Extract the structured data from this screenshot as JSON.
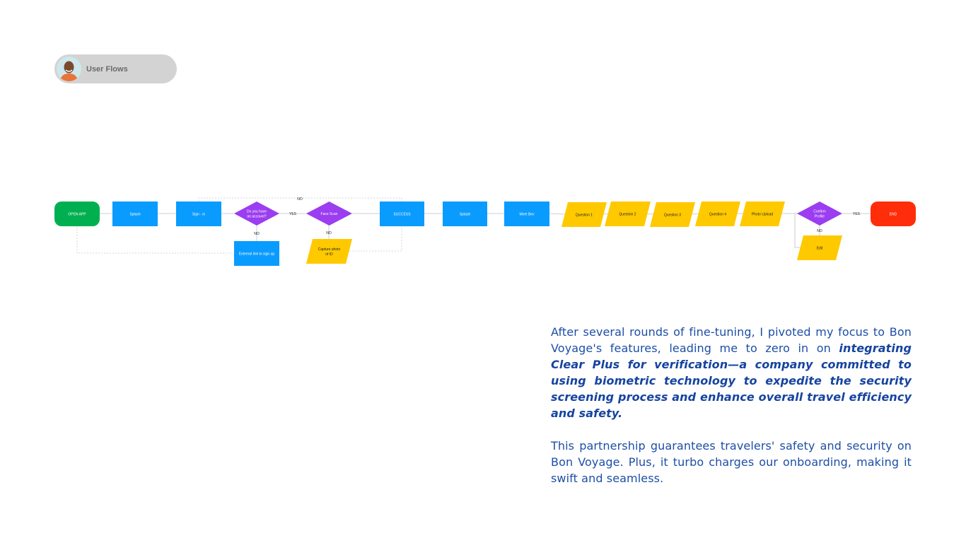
{
  "header": {
    "title": "User Flows",
    "avatar": "person-avatar"
  },
  "flow": {
    "nodes": [
      {
        "id": "open",
        "label": "OPEN APP",
        "shape": "terminal",
        "color": "#00b050"
      },
      {
        "id": "splash",
        "label": "Splash",
        "shape": "process",
        "color": "#0a9bff"
      },
      {
        "id": "signin",
        "label": "Sign - in",
        "shape": "process",
        "color": "#0a9bff"
      },
      {
        "id": "account",
        "label": [
          "Do you have",
          "an account?"
        ],
        "shape": "decision",
        "color": "#9b3df0"
      },
      {
        "id": "facescan",
        "label": "Face Scan",
        "shape": "decision",
        "color": "#9b3df0"
      },
      {
        "id": "success",
        "label": "SUCCESS",
        "shape": "process",
        "color": "#0a9bff"
      },
      {
        "id": "splash2",
        "label": "Splash",
        "shape": "process",
        "color": "#0a9bff"
      },
      {
        "id": "meetbev",
        "label": "Meet Bev",
        "shape": "process",
        "color": "#0a9bff"
      },
      {
        "id": "q1",
        "label": "Question 1",
        "shape": "data",
        "color": "#ffc900"
      },
      {
        "id": "q2",
        "label": "Question 2",
        "shape": "data",
        "color": "#ffc900"
      },
      {
        "id": "q3",
        "label": "Question 3",
        "shape": "data",
        "color": "#ffc900"
      },
      {
        "id": "q4",
        "label": "Question 4",
        "shape": "data",
        "color": "#ffc900"
      },
      {
        "id": "photo",
        "label": "Photo Upload",
        "shape": "data",
        "color": "#ffc900"
      },
      {
        "id": "confirm",
        "label": [
          "Confirm",
          "Profile"
        ],
        "shape": "decision",
        "color": "#9b3df0"
      },
      {
        "id": "end",
        "label": "END",
        "shape": "terminal",
        "color": "#ff2d0a"
      },
      {
        "id": "external",
        "label": "External link to sign up",
        "shape": "process",
        "color": "#0a9bff"
      },
      {
        "id": "capture",
        "label": [
          "Capture photo",
          "of ID"
        ],
        "shape": "data",
        "color": "#ffc900"
      },
      {
        "id": "edit",
        "label": "Edit",
        "shape": "data",
        "color": "#ffc900"
      }
    ],
    "edge_labels": {
      "no_top": "NO",
      "yes_account": "YES",
      "no_account": "NO",
      "no_face": "NO",
      "yes_confirm": "YES",
      "no_confirm": "NO"
    }
  },
  "content": {
    "p1_start": "After several rounds of fine-tuning, I pivoted my focus to Bon Voyage's features, leading me to zero in on ",
    "p1_emph": "integrating Clear Plus for verification—a company committed to using biometric technology to expedite the security screening process and enhance overall travel efficiency and safety.",
    "p2": "This partnership guarantees travelers' safety and security on Bon Voyage. Plus, it turbo charges our onboarding, making it swift and seamless."
  }
}
